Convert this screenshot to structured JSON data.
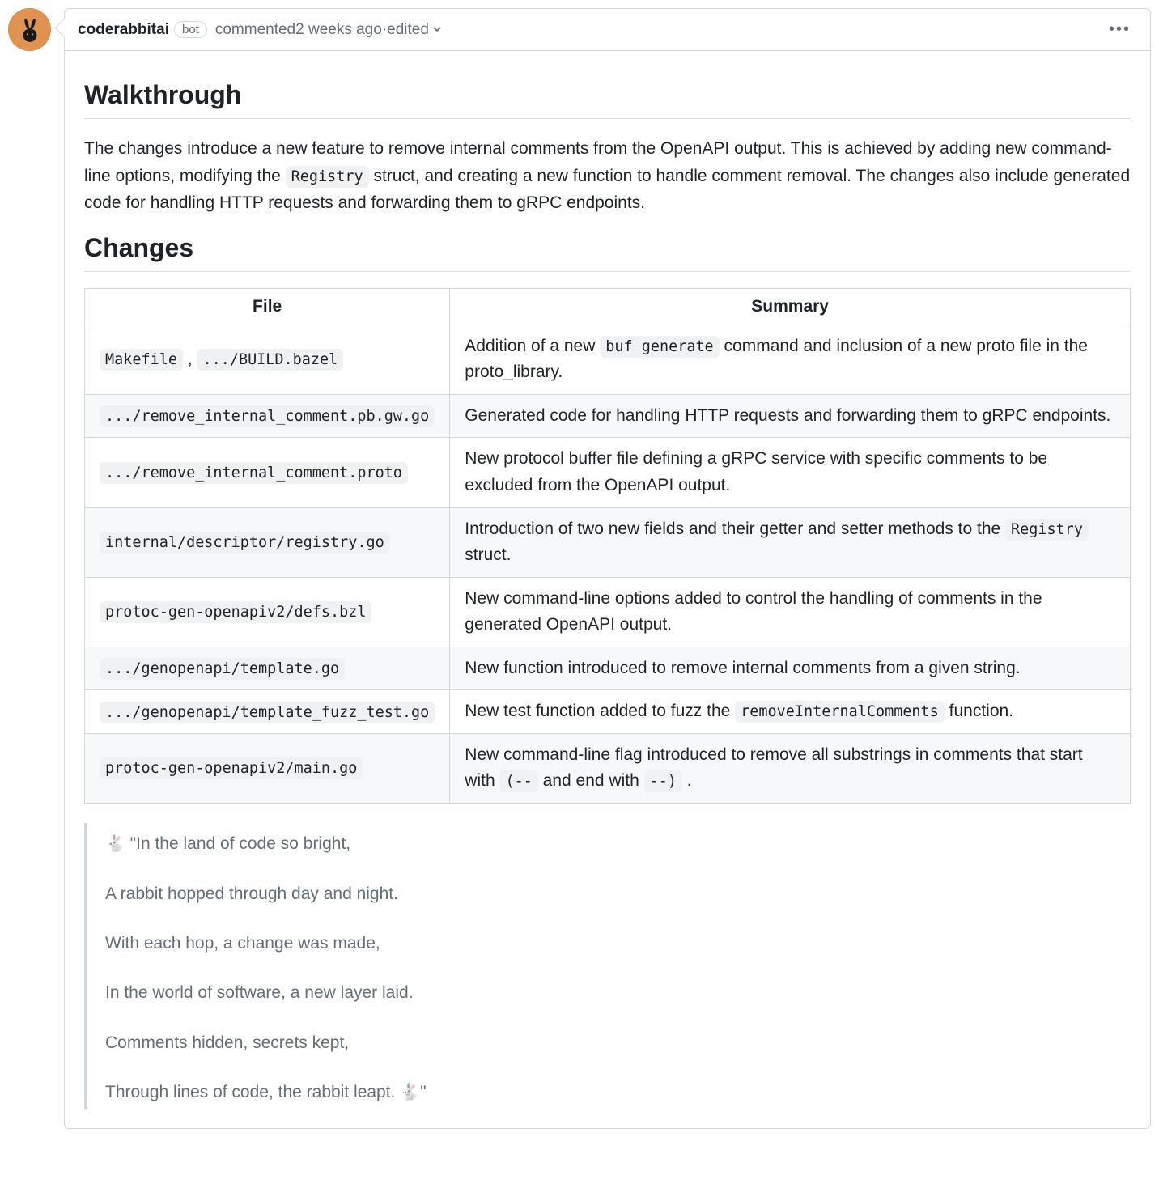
{
  "header": {
    "author": "coderabbitai",
    "bot_label": "bot",
    "commented_prefix": "commented ",
    "time_ago": "2 weeks ago",
    "separator": " · ",
    "edited": "edited"
  },
  "body": {
    "walkthrough_heading": "Walkthrough",
    "walkthrough_pre": "The changes introduce a new feature to remove internal comments from the OpenAPI output. This is achieved by adding new command-line options, modifying the ",
    "walkthrough_code": "Registry",
    "walkthrough_post": " struct, and creating a new function to handle comment removal. The changes also include generated code for handling HTTP requests and forwarding them to gRPC endpoints.",
    "changes_heading": "Changes"
  },
  "table": {
    "headers": {
      "file": "File",
      "summary": "Summary"
    },
    "rows": [
      {
        "files": [
          "Makefile",
          ".../BUILD.bazel"
        ],
        "file_sep": " , ",
        "summary_pre": "Addition of a new ",
        "summary_code": "buf generate",
        "summary_post": " command and inclusion of a new proto file in the proto_library."
      },
      {
        "files": [
          ".../remove_internal_comment.pb.gw.go"
        ],
        "summary_pre": "Generated code for handling HTTP requests and forwarding them to gRPC endpoints.",
        "summary_code": "",
        "summary_post": ""
      },
      {
        "files": [
          ".../remove_internal_comment.proto"
        ],
        "summary_pre": "New protocol buffer file defining a gRPC service with specific comments to be excluded from the OpenAPI output.",
        "summary_code": "",
        "summary_post": ""
      },
      {
        "files": [
          "internal/descriptor/registry.go"
        ],
        "summary_pre": "Introduction of two new fields and their getter and setter methods to the ",
        "summary_code": "Registry",
        "summary_post": " struct."
      },
      {
        "files": [
          "protoc-gen-openapiv2/defs.bzl"
        ],
        "summary_pre": "New command-line options added to control the handling of comments in the generated OpenAPI output.",
        "summary_code": "",
        "summary_post": ""
      },
      {
        "files": [
          ".../genopenapi/template.go"
        ],
        "summary_pre": "New function introduced to remove internal comments from a given string.",
        "summary_code": "",
        "summary_post": ""
      },
      {
        "files": [
          ".../genopenapi/template_fuzz_test.go"
        ],
        "summary_pre": "New test function added to fuzz the ",
        "summary_code": "removeInternalComments",
        "summary_post": " function."
      },
      {
        "files": [
          "protoc-gen-openapiv2/main.go"
        ],
        "summary_pre": "New command-line flag introduced to remove all substrings in comments that start with ",
        "summary_code": "(--",
        "summary_mid": " and end with ",
        "summary_code2": "--)",
        "summary_post": " ."
      }
    ]
  },
  "poem": {
    "emoji": "🐇",
    "line1_open": " \"In the land of code so bright,",
    "line2": "A rabbit hopped through day and night.",
    "line3": "With each hop, a change was made,",
    "line4": "In the world of software, a new layer laid.",
    "line5": "Comments hidden, secrets kept,",
    "line6_pre": "Through lines of code, the rabbit leapt. ",
    "line6_close": "\""
  }
}
